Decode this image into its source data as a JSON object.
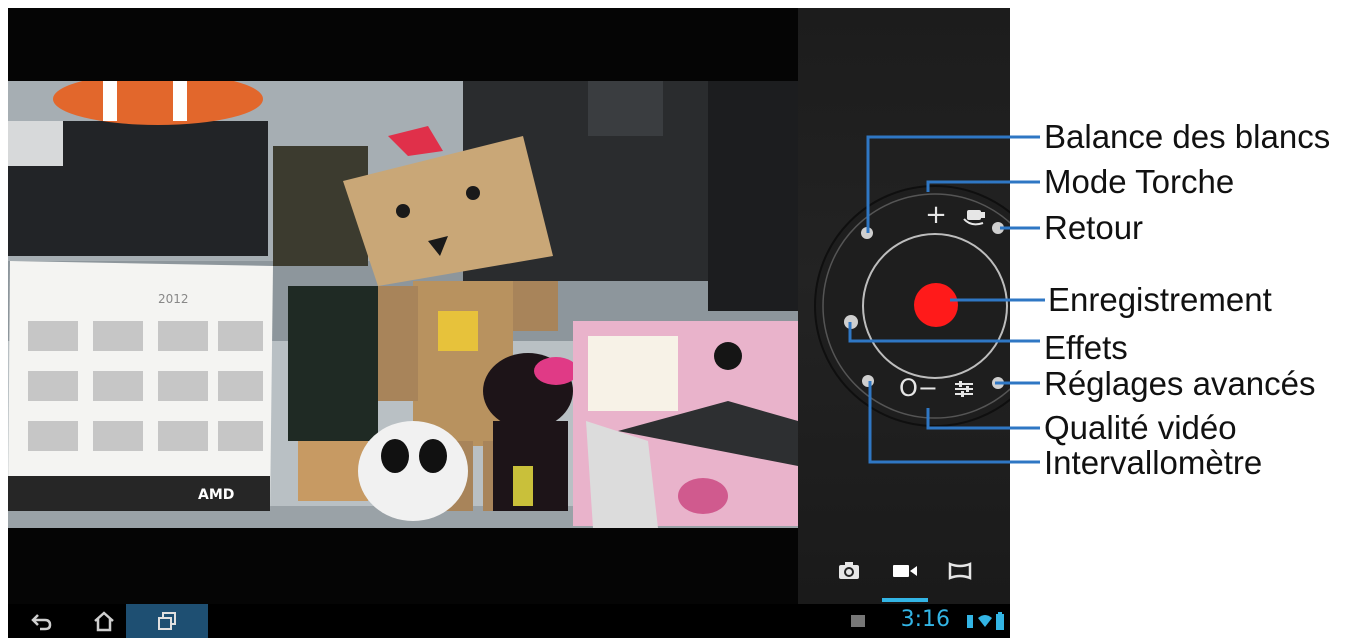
{
  "viewfinder": {
    "calendar_year": "2012",
    "calendar_brand": "AMD"
  },
  "camera_controls": {
    "plus_symbol": "+",
    "minus_symbol": "−",
    "zero_symbol": "O"
  },
  "modes": [
    {
      "icon": "camera-icon"
    },
    {
      "icon": "video-icon",
      "selected": true
    },
    {
      "icon": "panorama-icon"
    }
  ],
  "status_bar": {
    "time": "3:16"
  },
  "callouts": [
    {
      "label": "Balance des blancs"
    },
    {
      "label": "Mode Torche"
    },
    {
      "label": "Retour"
    },
    {
      "label": "Enregistrement"
    },
    {
      "label": "Effets"
    },
    {
      "label": "Réglages avancés"
    },
    {
      "label": "Qualité vidéo"
    },
    {
      "label": "Intervallomètre"
    }
  ],
  "colors": {
    "accent": "#33b5e5",
    "callout_line": "#2f77c4",
    "record": "#ff1a1a"
  }
}
